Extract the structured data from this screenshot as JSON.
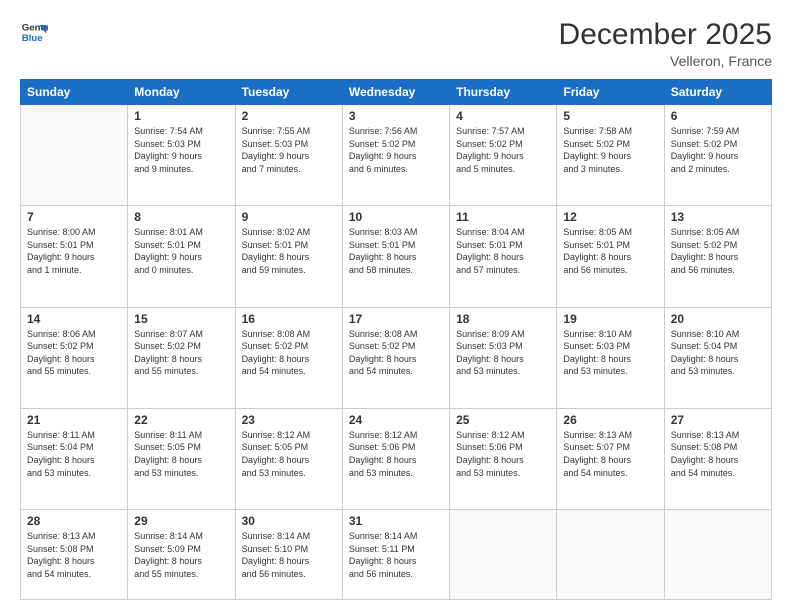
{
  "header": {
    "logo_line1": "General",
    "logo_line2": "Blue",
    "month": "December 2025",
    "location": "Velleron, France"
  },
  "weekdays": [
    "Sunday",
    "Monday",
    "Tuesday",
    "Wednesday",
    "Thursday",
    "Friday",
    "Saturday"
  ],
  "weeks": [
    [
      {
        "day": "",
        "info": ""
      },
      {
        "day": "1",
        "info": "Sunrise: 7:54 AM\nSunset: 5:03 PM\nDaylight: 9 hours\nand 9 minutes."
      },
      {
        "day": "2",
        "info": "Sunrise: 7:55 AM\nSunset: 5:03 PM\nDaylight: 9 hours\nand 7 minutes."
      },
      {
        "day": "3",
        "info": "Sunrise: 7:56 AM\nSunset: 5:02 PM\nDaylight: 9 hours\nand 6 minutes."
      },
      {
        "day": "4",
        "info": "Sunrise: 7:57 AM\nSunset: 5:02 PM\nDaylight: 9 hours\nand 5 minutes."
      },
      {
        "day": "5",
        "info": "Sunrise: 7:58 AM\nSunset: 5:02 PM\nDaylight: 9 hours\nand 3 minutes."
      },
      {
        "day": "6",
        "info": "Sunrise: 7:59 AM\nSunset: 5:02 PM\nDaylight: 9 hours\nand 2 minutes."
      }
    ],
    [
      {
        "day": "7",
        "info": "Sunrise: 8:00 AM\nSunset: 5:01 PM\nDaylight: 9 hours\nand 1 minute."
      },
      {
        "day": "8",
        "info": "Sunrise: 8:01 AM\nSunset: 5:01 PM\nDaylight: 9 hours\nand 0 minutes."
      },
      {
        "day": "9",
        "info": "Sunrise: 8:02 AM\nSunset: 5:01 PM\nDaylight: 8 hours\nand 59 minutes."
      },
      {
        "day": "10",
        "info": "Sunrise: 8:03 AM\nSunset: 5:01 PM\nDaylight: 8 hours\nand 58 minutes."
      },
      {
        "day": "11",
        "info": "Sunrise: 8:04 AM\nSunset: 5:01 PM\nDaylight: 8 hours\nand 57 minutes."
      },
      {
        "day": "12",
        "info": "Sunrise: 8:05 AM\nSunset: 5:01 PM\nDaylight: 8 hours\nand 56 minutes."
      },
      {
        "day": "13",
        "info": "Sunrise: 8:05 AM\nSunset: 5:02 PM\nDaylight: 8 hours\nand 56 minutes."
      }
    ],
    [
      {
        "day": "14",
        "info": "Sunrise: 8:06 AM\nSunset: 5:02 PM\nDaylight: 8 hours\nand 55 minutes."
      },
      {
        "day": "15",
        "info": "Sunrise: 8:07 AM\nSunset: 5:02 PM\nDaylight: 8 hours\nand 55 minutes."
      },
      {
        "day": "16",
        "info": "Sunrise: 8:08 AM\nSunset: 5:02 PM\nDaylight: 8 hours\nand 54 minutes."
      },
      {
        "day": "17",
        "info": "Sunrise: 8:08 AM\nSunset: 5:02 PM\nDaylight: 8 hours\nand 54 minutes."
      },
      {
        "day": "18",
        "info": "Sunrise: 8:09 AM\nSunset: 5:03 PM\nDaylight: 8 hours\nand 53 minutes."
      },
      {
        "day": "19",
        "info": "Sunrise: 8:10 AM\nSunset: 5:03 PM\nDaylight: 8 hours\nand 53 minutes."
      },
      {
        "day": "20",
        "info": "Sunrise: 8:10 AM\nSunset: 5:04 PM\nDaylight: 8 hours\nand 53 minutes."
      }
    ],
    [
      {
        "day": "21",
        "info": "Sunrise: 8:11 AM\nSunset: 5:04 PM\nDaylight: 8 hours\nand 53 minutes."
      },
      {
        "day": "22",
        "info": "Sunrise: 8:11 AM\nSunset: 5:05 PM\nDaylight: 8 hours\nand 53 minutes."
      },
      {
        "day": "23",
        "info": "Sunrise: 8:12 AM\nSunset: 5:05 PM\nDaylight: 8 hours\nand 53 minutes."
      },
      {
        "day": "24",
        "info": "Sunrise: 8:12 AM\nSunset: 5:06 PM\nDaylight: 8 hours\nand 53 minutes."
      },
      {
        "day": "25",
        "info": "Sunrise: 8:12 AM\nSunset: 5:06 PM\nDaylight: 8 hours\nand 53 minutes."
      },
      {
        "day": "26",
        "info": "Sunrise: 8:13 AM\nSunset: 5:07 PM\nDaylight: 8 hours\nand 54 minutes."
      },
      {
        "day": "27",
        "info": "Sunrise: 8:13 AM\nSunset: 5:08 PM\nDaylight: 8 hours\nand 54 minutes."
      }
    ],
    [
      {
        "day": "28",
        "info": "Sunrise: 8:13 AM\nSunset: 5:08 PM\nDaylight: 8 hours\nand 54 minutes."
      },
      {
        "day": "29",
        "info": "Sunrise: 8:14 AM\nSunset: 5:09 PM\nDaylight: 8 hours\nand 55 minutes."
      },
      {
        "day": "30",
        "info": "Sunrise: 8:14 AM\nSunset: 5:10 PM\nDaylight: 8 hours\nand 56 minutes."
      },
      {
        "day": "31",
        "info": "Sunrise: 8:14 AM\nSunset: 5:11 PM\nDaylight: 8 hours\nand 56 minutes."
      },
      {
        "day": "",
        "info": ""
      },
      {
        "day": "",
        "info": ""
      },
      {
        "day": "",
        "info": ""
      }
    ]
  ]
}
